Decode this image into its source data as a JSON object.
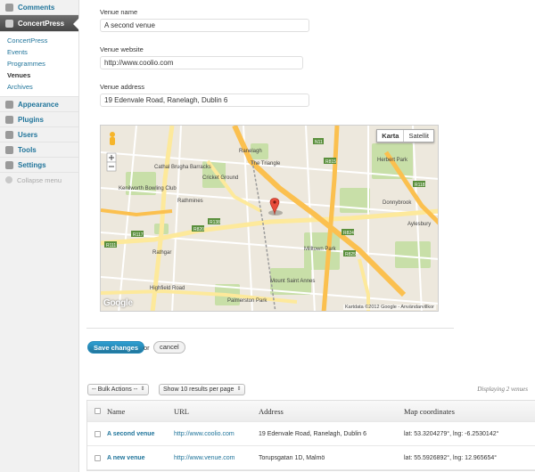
{
  "sidebar": {
    "top_item": "Comments",
    "current_item": "ConcertPress",
    "submenu": [
      "ConcertPress",
      "Events",
      "Programmes",
      "Venues",
      "Archives"
    ],
    "active_submenu": "Venues",
    "items": [
      "Appearance",
      "Plugins",
      "Users",
      "Tools",
      "Settings"
    ],
    "collapse": "Collapse menu"
  },
  "form": {
    "venue_name_label": "Venue name",
    "venue_name_value": "A second venue",
    "venue_website_label": "Venue website",
    "venue_website_value": "http://www.coolio.com",
    "venue_address_label": "Venue address",
    "venue_address_value": "19 Edenvale Road, Ranelagh, Dublin 6"
  },
  "map": {
    "type_map": "Karta",
    "type_satellite": "Satellit",
    "copyright": "Kartdata ©2012 Google - Användarvillkor",
    "logo": "Google",
    "labels": [
      "Ranelagh",
      "The Triangle",
      "Cathal Brugha Barracks",
      "Kenilworth Bowling Club",
      "Cricket Ground",
      "Rathmines",
      "Rathgar",
      "Highfield Road",
      "Palmerston Park",
      "Mount Saint Annes",
      "Milltown Park",
      "Herbert Park",
      "Donnybrook",
      "Aylesbury",
      "R117",
      "R138",
      "R824",
      "R825",
      "R820",
      "R815",
      "R111",
      "N11",
      "R118"
    ]
  },
  "actions": {
    "save": "Save changes",
    "or": "or",
    "cancel": "cancel"
  },
  "table_controls": {
    "bulk_actions": "-- Bulk Actions --",
    "per_page": "Show 10 results per page",
    "displaying": "Displaying 2 venues"
  },
  "table": {
    "headers": [
      "Name",
      "URL",
      "Address",
      "Map coordinates"
    ],
    "rows": [
      {
        "name": "A second venue",
        "url": "http://www.coolio.com",
        "address": "19 Edenvale Road, Ranelagh, Dublin 6",
        "coords": "lat: 53.3204279°, lng: -6.2530142°"
      },
      {
        "name": "A new venue",
        "url": "http://www.venue.com",
        "address": "Torupsgatan 1D, Malmö",
        "coords": "lat: 55.5926892°, lng: 12.965654°"
      }
    ]
  },
  "colors": {
    "link": "#21759b",
    "primary_button": "#21759b",
    "sidebar_current": "#464646"
  }
}
